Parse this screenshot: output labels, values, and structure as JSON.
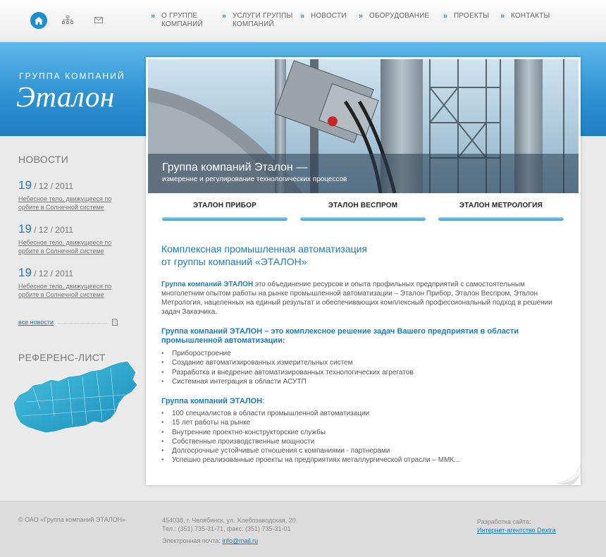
{
  "nav": {
    "items": [
      {
        "label": "О ГРУППЕ\nКОМПАНИЙ"
      },
      {
        "label": "УСЛУГИ ГРУППЫ\nКОМПАНИЙ"
      },
      {
        "label": "НОВОСТИ"
      },
      {
        "label": "ОБОРУДОВАНИЕ"
      },
      {
        "label": "ПРОЕКТЫ"
      },
      {
        "label": "КОНТАКТЫ"
      }
    ]
  },
  "logo": {
    "small": "ГРУППА КОМПАНИЙ",
    "big": "Эталон"
  },
  "sidebar": {
    "news_title": "НОВОСТИ",
    "news": [
      {
        "day": "19",
        "rest": " / 12 / 2011",
        "text": "Небесное тело, движущееся по орбите в Солнечной системе"
      },
      {
        "day": "19",
        "rest": " / 12 / 2011",
        "text": "Небесное тело, движущееся по орбите в Солнечной системе"
      },
      {
        "day": "19",
        "rest": " / 12 / 2011",
        "text": "Небесное тело, движущееся по орбите в Солнечной системе"
      }
    ],
    "all_news": "все новости",
    "ref_title": "РЕФЕРЕНС-ЛИСТ"
  },
  "banner": {
    "title": "Группа компаний Эталон —",
    "subtitle": "измерение и регулирование технологических процессов"
  },
  "tabs": [
    {
      "label": "ЭТАЛОН ПРИБОР"
    },
    {
      "label": "ЭТАЛОН ВЕСПРОМ"
    },
    {
      "label": "ЭТАЛОН МЕТРОЛОГИЯ"
    }
  ],
  "content": {
    "heading": "Комплексная промышленная автоматизация\nот группы компаний «ЭТАЛОН»",
    "para_lead": "Группа компаний ЭТАЛОН",
    "para_rest": " это объединение ресурсов и опыта профильных предприятий с самостоятельным многолетним опытом работы на рынке промышленной автоматизации – Эталон Прибор, Эталон Веспром, Эталон Метрология, нацеленных на единый результат и обеспечивающих комплексный профессиональный подход в решении задач Заказчика.",
    "sub1": "Группа компаний ЭТАЛОН – это комплексное решение задач Вашего предприятия в области промышленной автоматизации:",
    "list1": [
      "Приборостроение",
      "Создание автоматизированных измерительных систем",
      "Разработка и внедрение автоматизированных технологических агрегатов",
      "Системная интеграция в области АСУТП"
    ],
    "sub2_bold": "Группа компаний ЭТАЛОН",
    "sub2_rest": ":",
    "list2": [
      "100 специалистов в области промышленной автоматизации",
      "15 лет работы на рынке",
      "Внутренние проектно-конструкторские службы",
      "Собственные производственные мощности",
      "Долгосрочные устойчивые отношения с компаниями - партнерами",
      "Успешно реализованные проекты на предприятиях металлургической отрасли – ММК..."
    ]
  },
  "footer": {
    "copyright": "© ОАО «Группа компаний ЭТАЛОН»",
    "address": "454038, г. Челябинск, ул. Хлебозаводская, 20",
    "phone": "Тел.: (351) 735-31-71, факс: (351) 735-31-01",
    "email_label": "Электронная почта: ",
    "email": "info@mail.ru",
    "dev_label": "Разработка сайта:",
    "dev_link": "Интернет-агентство Dextra"
  },
  "colors": {
    "accent": "#1a7cc0",
    "band": "#2f93d2"
  },
  "icons": [
    "home-icon",
    "sitemap-icon",
    "mail-icon",
    "chevron-right-icon",
    "document-icon",
    "russia-map"
  ]
}
